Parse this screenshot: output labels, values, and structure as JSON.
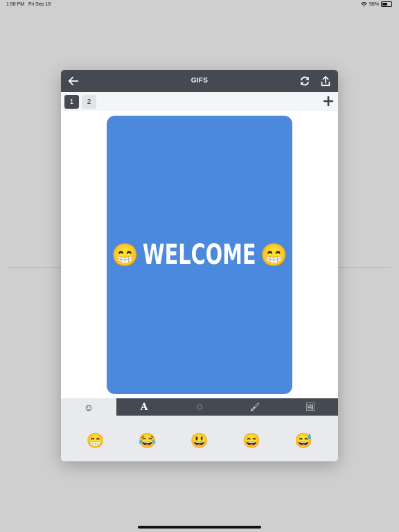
{
  "status_bar": {
    "time": "1:58 PM",
    "date": "Fri Sep 18",
    "battery": "58%",
    "battery_level": 0.58
  },
  "dialog": {
    "title": "GIFS",
    "icons": {
      "back": "arrow-left-icon",
      "refresh": "refresh-icon",
      "share": "share-icon",
      "add_page": "plus-icon"
    },
    "pages": [
      {
        "label": "1",
        "active": true
      },
      {
        "label": "2",
        "active": false
      }
    ],
    "card": {
      "text": "WELCOME",
      "emoji_left": "😁",
      "emoji_right": "😁",
      "background_color": "#4b89dc"
    },
    "tool_tabs": [
      {
        "name": "emoji",
        "icon": "smiley-icon",
        "glyph": "☺",
        "active": true
      },
      {
        "name": "text",
        "icon": "text-icon",
        "glyph": "A",
        "active": false
      },
      {
        "name": "shape",
        "icon": "circle-dashed-icon",
        "glyph": "◌",
        "active": false
      },
      {
        "name": "brush",
        "icon": "brush-icon",
        "glyph": "🖌",
        "active": false
      },
      {
        "name": "image",
        "icon": "image-icon",
        "glyph": "🖼",
        "active": false
      }
    ],
    "emoji_tray": [
      "😁",
      "😂",
      "😃",
      "😄",
      "😅"
    ]
  },
  "colors": {
    "header": "#454a52",
    "accent_blue": "#4b89dc",
    "page_background": "#cfcfcf"
  }
}
